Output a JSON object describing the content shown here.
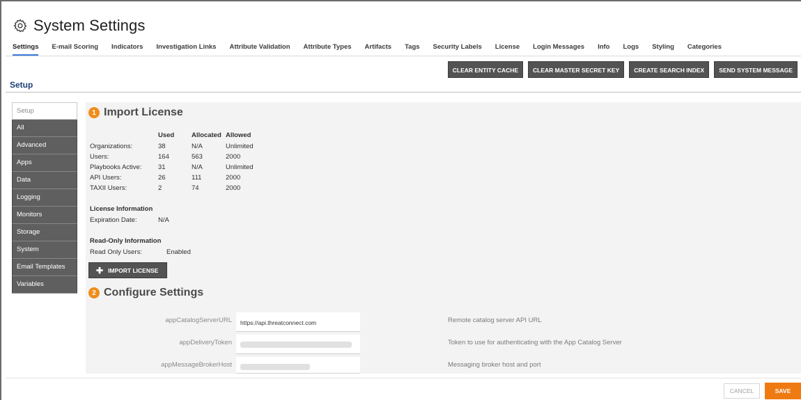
{
  "app": {
    "title": "System Settings",
    "title_icon": "gear-icon"
  },
  "tabs": [
    {
      "label": "Settings",
      "active": true
    },
    {
      "label": "E-mail Scoring"
    },
    {
      "label": "Indicators"
    },
    {
      "label": "Investigation Links"
    },
    {
      "label": "Attribute Validation"
    },
    {
      "label": "Attribute Types"
    },
    {
      "label": "Artifacts"
    },
    {
      "label": "Tags"
    },
    {
      "label": "Security Labels"
    },
    {
      "label": "License"
    },
    {
      "label": "Login Messages"
    },
    {
      "label": "Info"
    },
    {
      "label": "Logs"
    },
    {
      "label": "Styling"
    },
    {
      "label": "Categories"
    }
  ],
  "actions": {
    "clear_entity_cache": "CLEAR ENTITY CACHE",
    "clear_master_secret_key": "CLEAR MASTER SECRET KEY",
    "create_search_index": "CREATE SEARCH INDEX",
    "send_system_message": "SEND SYSTEM MESSAGE"
  },
  "section_heading": "Setup",
  "sidebar": {
    "items": [
      "Setup",
      "All",
      "Advanced",
      "Apps",
      "Data",
      "Logging",
      "Monitors",
      "Storage",
      "System",
      "Email Templates",
      "Variables"
    ]
  },
  "import_license": {
    "step": "1",
    "title": "Import License",
    "headers": {
      "used": "Used",
      "allocated": "Allocated",
      "allowed": "Allowed"
    },
    "rows": [
      {
        "label": "Organizations:",
        "used": "38",
        "allocated": "N/A",
        "allowed": "Unlimited"
      },
      {
        "label": "Users:",
        "used": "164",
        "allocated": "563",
        "allowed": "2000"
      },
      {
        "label": "Playbooks Active:",
        "used": "31",
        "allocated": "N/A",
        "allowed": "Unlimited"
      },
      {
        "label": "API Users:",
        "used": "26",
        "allocated": "111",
        "allowed": "2000"
      },
      {
        "label": "TAXII Users:",
        "used": "2",
        "allocated": "74",
        "allowed": "2000"
      }
    ],
    "license_info": {
      "heading": "License Information",
      "label": "Expiration Date:",
      "value": "N/A"
    },
    "readonly_info": {
      "heading": "Read-Only Information",
      "label": "Read Only Users:",
      "value": "Enabled"
    },
    "button": "IMPORT LICENSE"
  },
  "configure": {
    "step": "2",
    "title": "Configure Settings",
    "rows": [
      {
        "name": "appCatalogServerURL",
        "value": "https://api.threatconnect.com",
        "description": "Remote catalog server API URL"
      },
      {
        "name": "appDeliveryToken",
        "value": "",
        "description": "Token to use for authenticating with the App Catalog Server"
      },
      {
        "name": "appMessageBrokerHost",
        "value": "",
        "description": "Messaging broker host and port"
      }
    ]
  },
  "footer": {
    "cancel": "CANCEL",
    "save": "SAVE"
  },
  "colors": {
    "accent_orange": "#f07a12",
    "tab_underline": "#3a79d8",
    "dark_button": "#535353",
    "heading_blue": "#1d3f73"
  }
}
